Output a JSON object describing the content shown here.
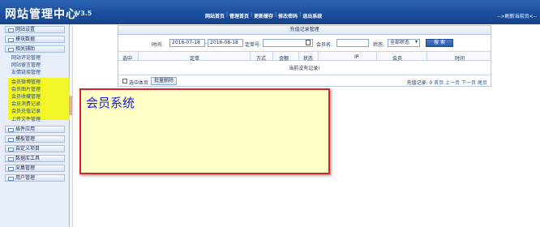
{
  "header": {
    "logo": "网站管理中心",
    "version": "V3.5",
    "nav": [
      "网站首页",
      "管理首页",
      "更新缓存",
      "修改密码",
      "退出系统"
    ],
    "right_link": "-->刷新当前页<--"
  },
  "sidebar": {
    "groups_top": [
      "网站设置",
      "模块数据",
      "相关辅助"
    ],
    "sub_items": [
      "网站评论管理",
      "网站留言管理",
      "友情链接管理"
    ],
    "highlighted_items": [
      "会员微博管理",
      "会员图片管理",
      "会员收藏管理",
      "会员消费记录",
      "会员充值记录"
    ],
    "after_highlight": "上传文件管理",
    "groups_bottom": [
      "插件应用",
      "模板管理",
      "自定义项目",
      "数据库工具",
      "采集管理",
      "用户管理"
    ]
  },
  "panel": {
    "title": "充值记录管理",
    "filter": {
      "time_label": "时间:",
      "date_from": "2016-07-18",
      "sep": "-",
      "date_to": "2016-08-18",
      "order_label": "定单号:",
      "order_value": "",
      "member_label": "会员名:",
      "member_value": "",
      "status_label": "状态:",
      "status_value": "全部状态",
      "search_button": "搜 索"
    },
    "columns": [
      "选中",
      "定单",
      "方式",
      "金额",
      "状态",
      "IP",
      "会员",
      "时间"
    ],
    "empty_text": "当前没有记录!",
    "footer": {
      "select_page": "选中本页",
      "batch_delete": "批量删除",
      "record_count": "充值记录: 0",
      "pager": [
        "首页",
        "上一页",
        "下一页",
        "尾页"
      ]
    }
  },
  "callout": {
    "text": "会员系统"
  },
  "colors": {
    "header_blue": "#1a4d9c",
    "highlight_yellow": "#f2f51c",
    "callout_border": "#d2252b",
    "callout_fill": "#ffffc8",
    "callout_text": "#1a1ad0"
  }
}
